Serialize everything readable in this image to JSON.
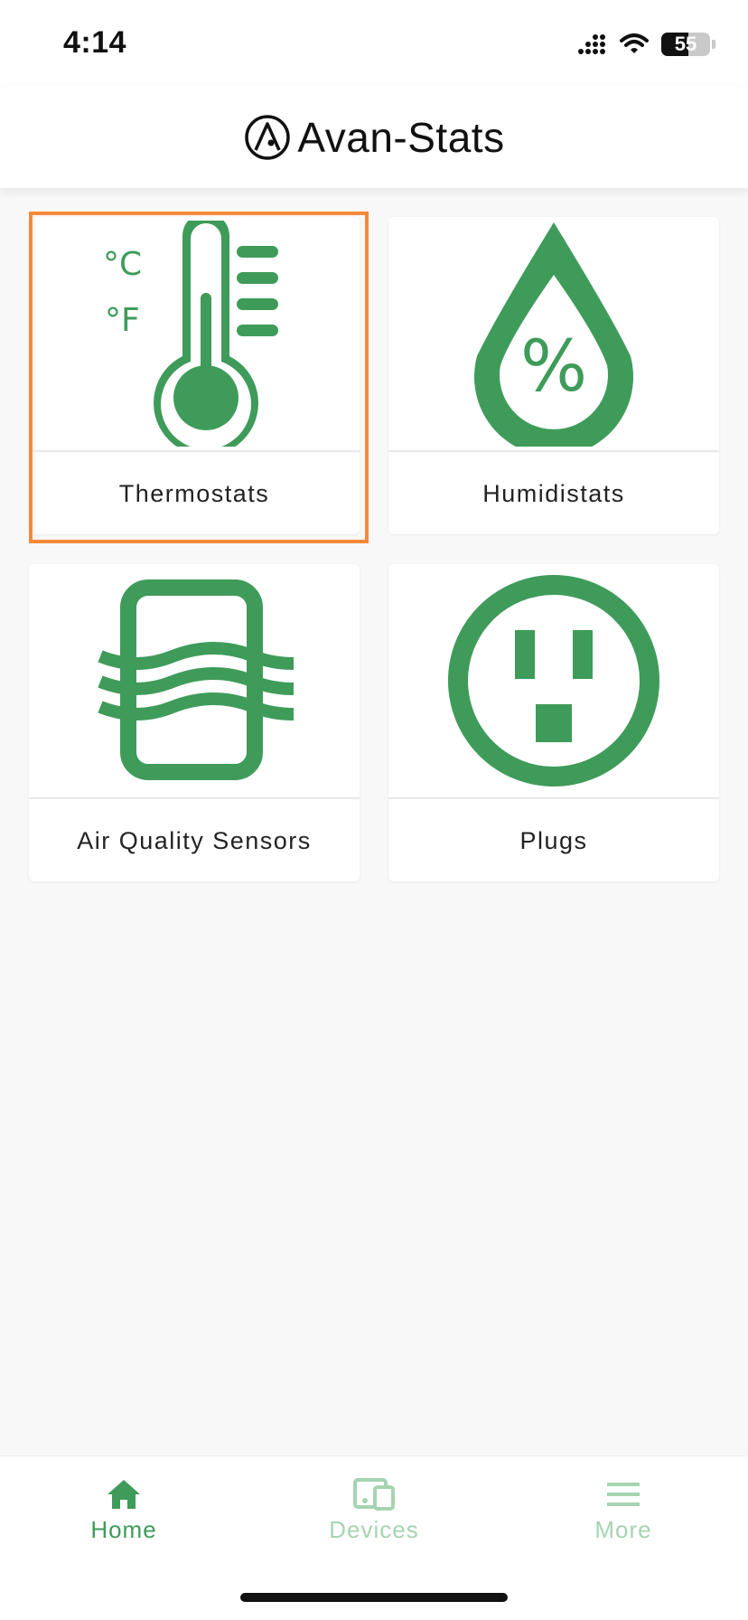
{
  "status_bar": {
    "time": "4:14",
    "battery": "55"
  },
  "header": {
    "title": "Avan-Stats"
  },
  "colors": {
    "accent": "#3f9b5a",
    "accent_light": "#a6d4b2",
    "highlight": "#f58a3a"
  },
  "categories": [
    {
      "label": "Thermostats",
      "icon": "thermometer-icon"
    },
    {
      "label": "Humidistats",
      "icon": "humidity-drop-icon"
    },
    {
      "label": "Air Quality Sensors",
      "icon": "air-filter-icon"
    },
    {
      "label": "Plugs",
      "icon": "outlet-icon"
    }
  ],
  "tabs": [
    {
      "label": "Home",
      "icon": "home-icon",
      "active": true
    },
    {
      "label": "Devices",
      "icon": "devices-icon",
      "active": false
    },
    {
      "label": "More",
      "icon": "menu-icon",
      "active": false
    }
  ]
}
